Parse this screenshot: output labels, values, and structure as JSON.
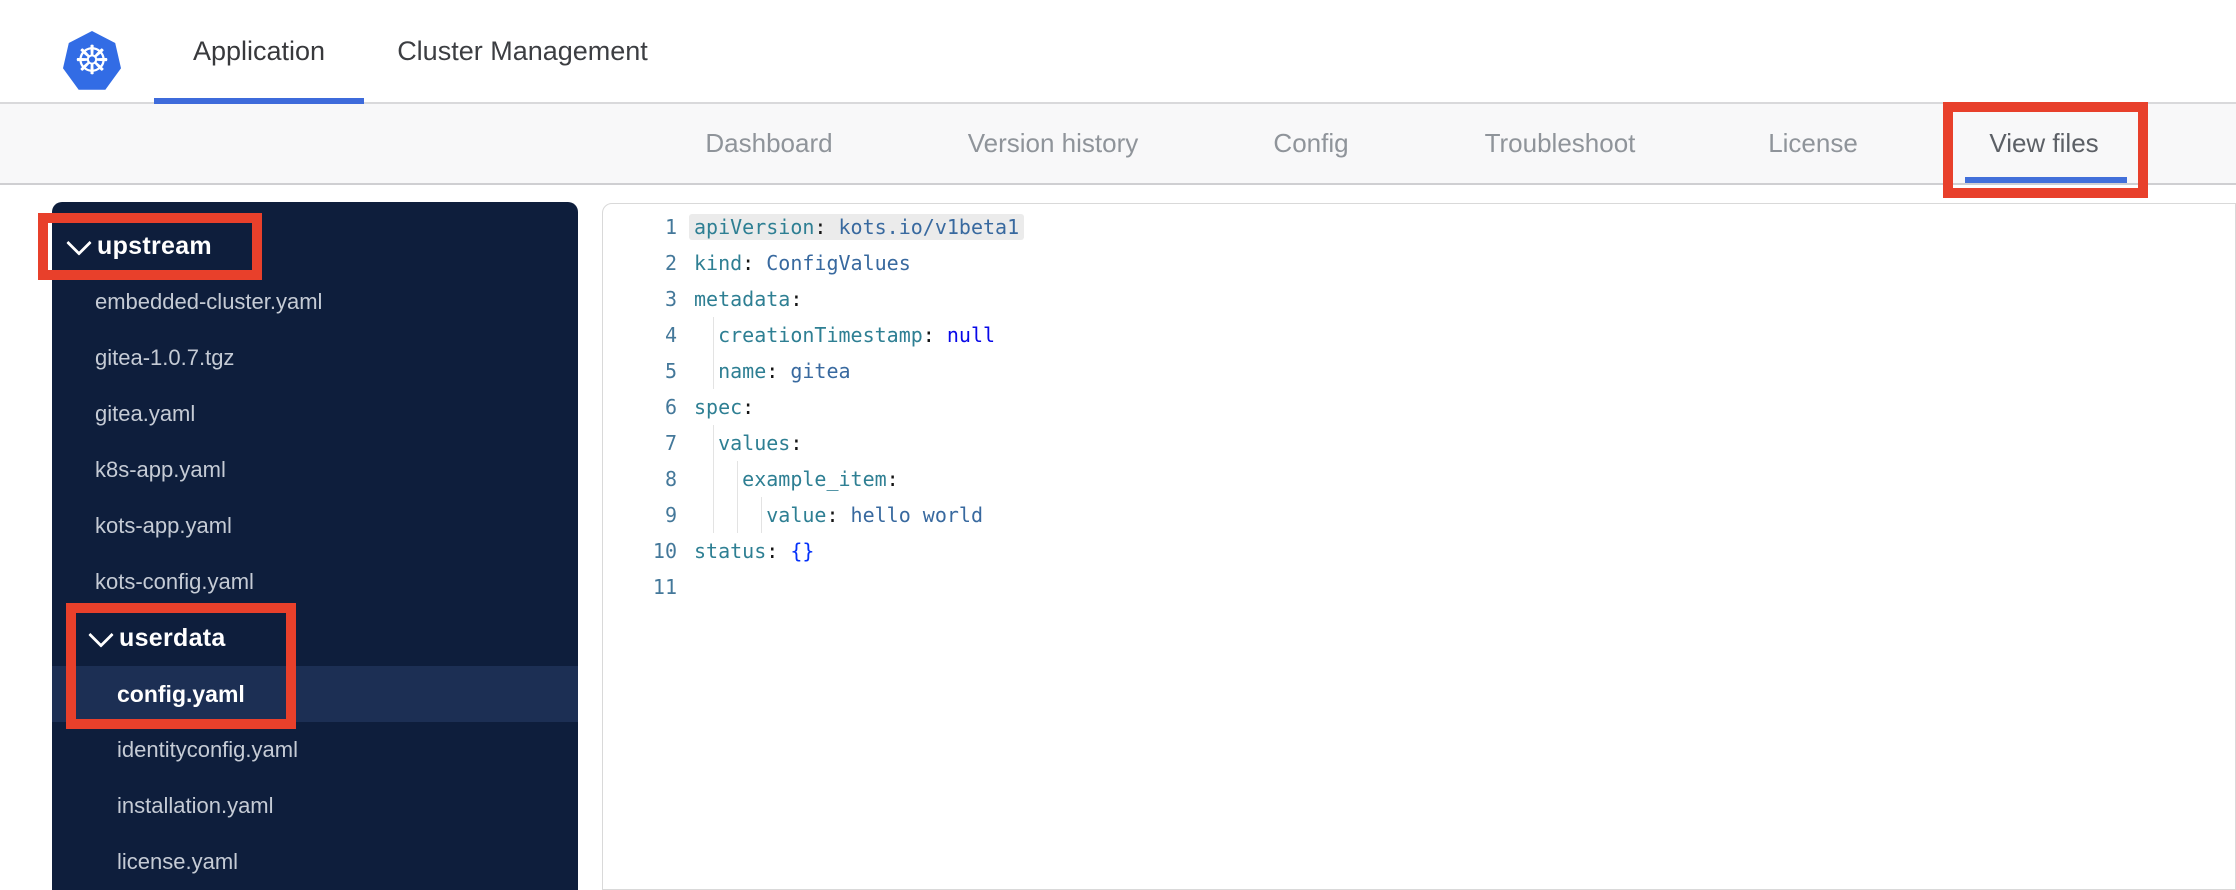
{
  "topbar": {
    "logo": "kubernetes-logo",
    "tabs": [
      {
        "label": "Application",
        "active": true
      },
      {
        "label": "Cluster Management",
        "active": false
      }
    ]
  },
  "subnav": {
    "tabs": [
      {
        "label": "Dashboard",
        "active": false
      },
      {
        "label": "Version history",
        "active": false
      },
      {
        "label": "Config",
        "active": false
      },
      {
        "label": "Troubleshoot",
        "active": false
      },
      {
        "label": "License",
        "active": false
      },
      {
        "label": "View files",
        "active": true
      }
    ]
  },
  "sidebar": {
    "rows": [
      {
        "label": "upstream",
        "type": "folder",
        "level": 1,
        "expanded": true
      },
      {
        "label": "embedded-cluster.yaml",
        "type": "file",
        "level": 1
      },
      {
        "label": "gitea-1.0.7.tgz",
        "type": "file",
        "level": 1
      },
      {
        "label": "gitea.yaml",
        "type": "file",
        "level": 1
      },
      {
        "label": "k8s-app.yaml",
        "type": "file",
        "level": 1
      },
      {
        "label": "kots-app.yaml",
        "type": "file",
        "level": 1
      },
      {
        "label": "kots-config.yaml",
        "type": "file",
        "level": 1
      },
      {
        "label": "userdata",
        "type": "folder",
        "level": 2,
        "expanded": true
      },
      {
        "label": "config.yaml",
        "type": "file",
        "level": 2,
        "selected": true
      },
      {
        "label": "identityconfig.yaml",
        "type": "file",
        "level": 2
      },
      {
        "label": "installation.yaml",
        "type": "file",
        "level": 2
      },
      {
        "label": "license.yaml",
        "type": "file",
        "level": 2
      }
    ]
  },
  "editor": {
    "language": "yaml",
    "lines": [
      {
        "num": 1,
        "indent": 0,
        "highlight": true,
        "tokens": [
          {
            "t": "key",
            "v": "apiVersion"
          },
          {
            "t": "punct",
            "v": ":"
          },
          {
            "t": "text",
            "v": " "
          },
          {
            "t": "val",
            "v": "kots.io/v1beta1"
          }
        ]
      },
      {
        "num": 2,
        "indent": 0,
        "tokens": [
          {
            "t": "key",
            "v": "kind"
          },
          {
            "t": "punct",
            "v": ":"
          },
          {
            "t": "text",
            "v": " "
          },
          {
            "t": "val",
            "v": "ConfigValues"
          }
        ]
      },
      {
        "num": 3,
        "indent": 0,
        "tokens": [
          {
            "t": "key",
            "v": "metadata"
          },
          {
            "t": "punct",
            "v": ":"
          }
        ]
      },
      {
        "num": 4,
        "indent": 2,
        "tokens": [
          {
            "t": "key",
            "v": "creationTimestamp"
          },
          {
            "t": "punct",
            "v": ":"
          },
          {
            "t": "text",
            "v": " "
          },
          {
            "t": "kw",
            "v": "null"
          }
        ]
      },
      {
        "num": 5,
        "indent": 2,
        "tokens": [
          {
            "t": "key",
            "v": "name"
          },
          {
            "t": "punct",
            "v": ":"
          },
          {
            "t": "text",
            "v": " "
          },
          {
            "t": "val",
            "v": "gitea"
          }
        ]
      },
      {
        "num": 6,
        "indent": 0,
        "tokens": [
          {
            "t": "key",
            "v": "spec"
          },
          {
            "t": "punct",
            "v": ":"
          }
        ]
      },
      {
        "num": 7,
        "indent": 2,
        "tokens": [
          {
            "t": "key",
            "v": "values"
          },
          {
            "t": "punct",
            "v": ":"
          }
        ]
      },
      {
        "num": 8,
        "indent": 4,
        "tokens": [
          {
            "t": "key",
            "v": "example_item"
          },
          {
            "t": "punct",
            "v": ":"
          }
        ]
      },
      {
        "num": 9,
        "indent": 6,
        "tokens": [
          {
            "t": "key",
            "v": "value"
          },
          {
            "t": "punct",
            "v": ":"
          },
          {
            "t": "text",
            "v": " "
          },
          {
            "t": "val",
            "v": "hello world"
          }
        ]
      },
      {
        "num": 10,
        "indent": 0,
        "tokens": [
          {
            "t": "key",
            "v": "status"
          },
          {
            "t": "punct",
            "v": ":"
          },
          {
            "t": "text",
            "v": " "
          },
          {
            "t": "bracket",
            "v": "{}"
          }
        ]
      },
      {
        "num": 11,
        "indent": 0,
        "tokens": []
      }
    ]
  },
  "annotations": {
    "color": "#e8402b",
    "boxes": [
      "view-files-tab",
      "upstream-folder",
      "userdata-and-config-yaml"
    ]
  },
  "colors": {
    "kubernetes_blue": "#326ce5",
    "active_tab_underline": "#3e6bdb",
    "sidebar_bg": "#0e1e3c",
    "sidebar_selected_row": "#1c2f54",
    "yaml_key": "#2e7f93",
    "yaml_value": "#38699f",
    "yaml_null": "#0808e8"
  }
}
